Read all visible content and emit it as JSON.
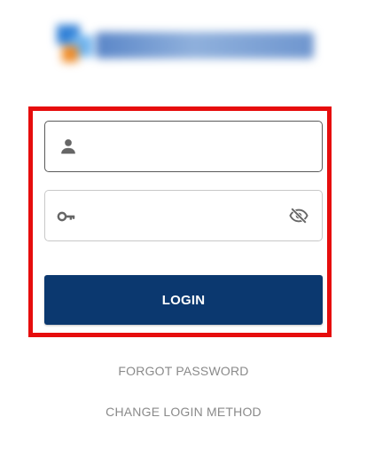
{
  "logo": {
    "icon": "company-logo"
  },
  "form": {
    "username": {
      "value": "",
      "placeholder": "",
      "icon": "person-icon"
    },
    "password": {
      "value": "",
      "placeholder": "",
      "icon": "key-icon",
      "toggle_icon": "eye-off-icon"
    },
    "login_label": "LOGIN"
  },
  "links": {
    "forgot_password": "FORGOT PASSWORD",
    "change_login_method": "CHANGE LOGIN METHOD"
  },
  "colors": {
    "button_bg": "#0b386f",
    "highlight": "#e60d0d",
    "link_text": "#8a8a8a",
    "icon": "#666666"
  }
}
